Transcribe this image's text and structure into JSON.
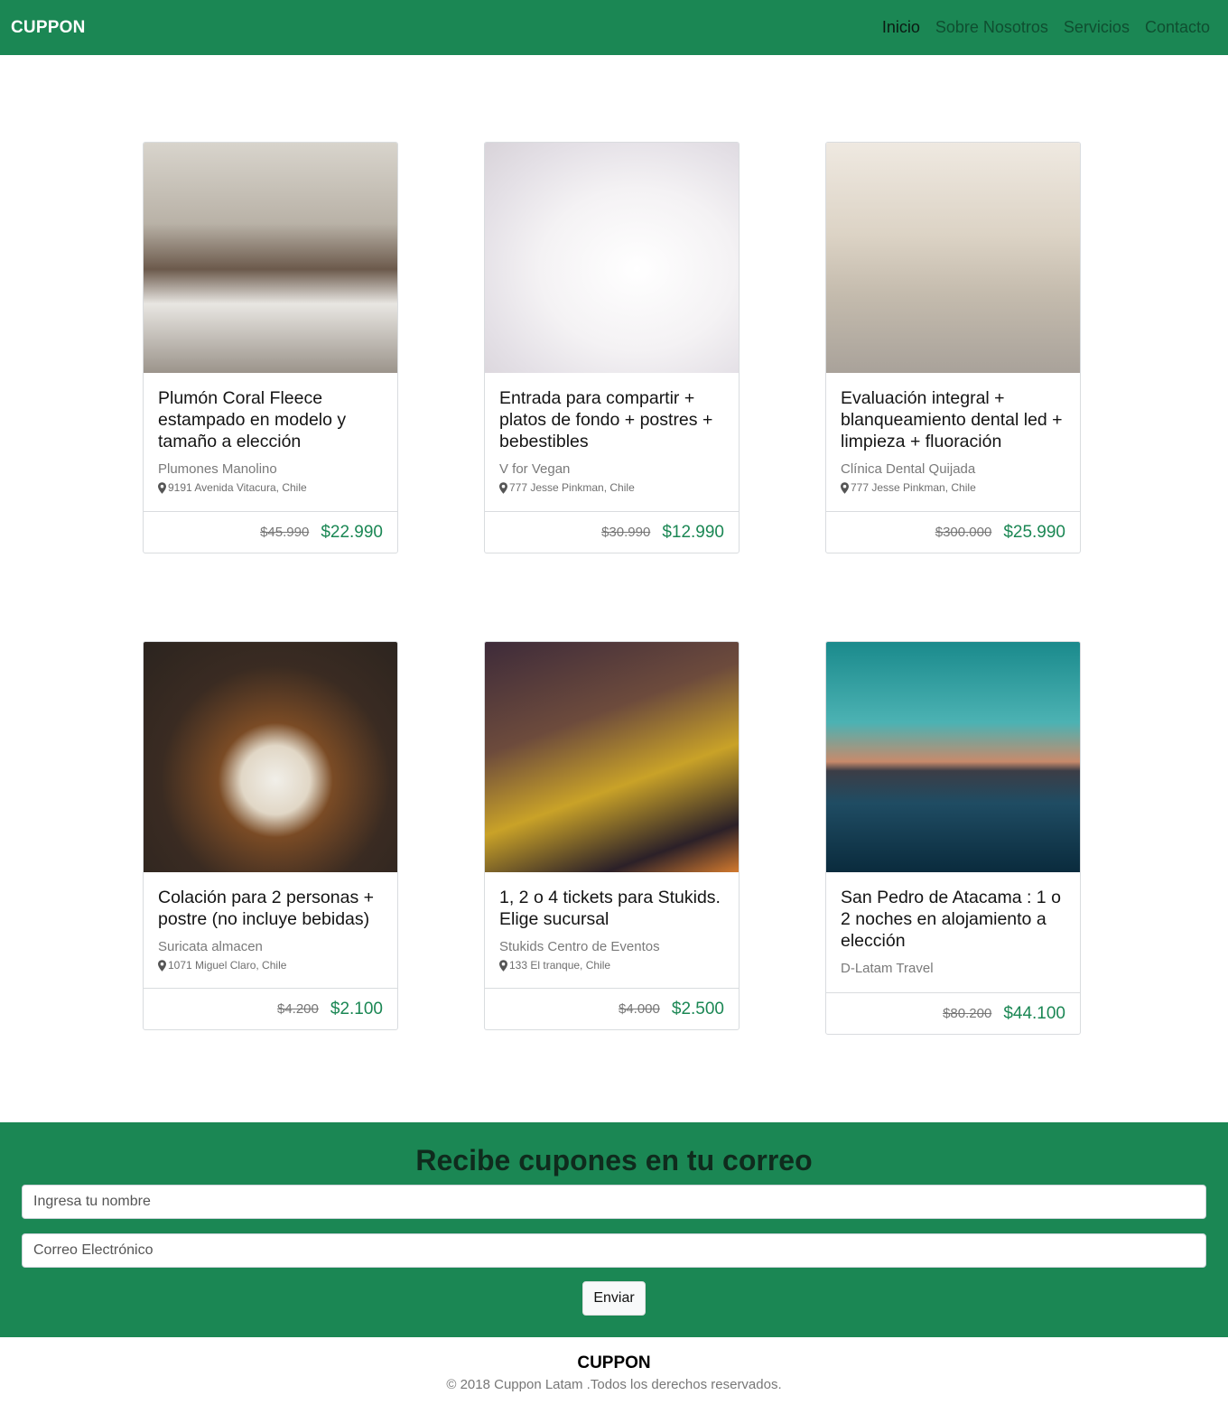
{
  "navbar": {
    "brand": "CUPPON",
    "links": [
      {
        "label": "Inicio",
        "active": true
      },
      {
        "label": "Sobre Nosotros",
        "active": false
      },
      {
        "label": "Servicios",
        "active": false
      },
      {
        "label": "Contacto",
        "active": false
      }
    ]
  },
  "colors": {
    "primary": "#1b8754",
    "price": "#1b8754"
  },
  "cards": [
    {
      "title": "Plumón Coral Fleece estampado en modelo y tamaño a elección",
      "vendor": "Plumones Manolino",
      "location": "9191 Avenida Vitacura, Chile",
      "old_price": "$45.990",
      "new_price": "$22.990",
      "image": "bedroom"
    },
    {
      "title": "Entrada para compartir + platos de fondo + postres + bebestibles",
      "vendor": "V for Vegan",
      "location": "777 Jesse Pinkman, Chile",
      "old_price": "$30.990",
      "new_price": "$12.990",
      "image": "salmon-dish"
    },
    {
      "title": "Evaluación integral + blanqueamiento dental led + limpieza + fluoración",
      "vendor": "Clínica Dental Quijada",
      "location": "777 Jesse Pinkman, Chile",
      "old_price": "$300.000",
      "new_price": "$25.990",
      "image": "dental-office"
    },
    {
      "title": "Colación para 2 personas + postre (no incluye bebidas)",
      "vendor": "Suricata almacen",
      "location": "1071 Miguel Claro, Chile",
      "old_price": "$4.200",
      "new_price": "$2.100",
      "image": "salad-plate"
    },
    {
      "title": "1, 2 o 4 tickets para Stukids. Elige sucursal",
      "vendor": "Stukids Centro de Eventos",
      "location": "133 El tranque, Chile",
      "old_price": "$4.000",
      "new_price": "$2.500",
      "image": "roller-coaster"
    },
    {
      "title": "San Pedro de Atacama : 1 o 2 noches en alojamiento a elección",
      "vendor": "D-Latam Travel",
      "location": "",
      "old_price": "$80.200",
      "new_price": "$44.100",
      "image": "atacama-lake"
    }
  ],
  "subscribe": {
    "title": "Recibe cupones en tu correo",
    "name_placeholder": "Ingresa tu nombre",
    "email_placeholder": "Correo Electrónico",
    "button_label": "Enviar"
  },
  "footer": {
    "brand": "CUPPON",
    "copyright": "© 2018 Cuppon Latam .Todos los derechos reservados."
  }
}
